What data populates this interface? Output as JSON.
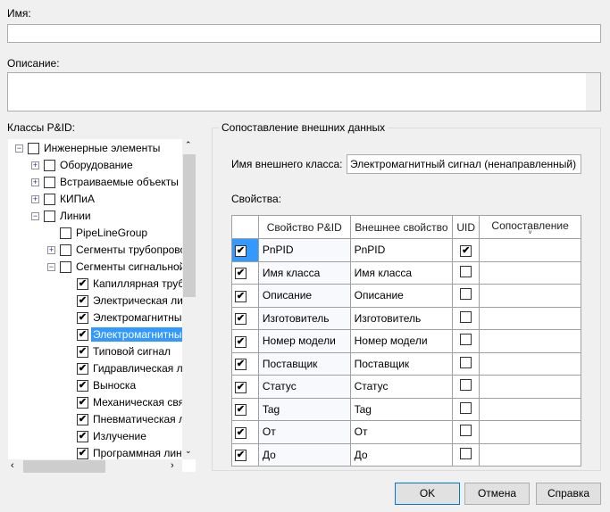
{
  "name": {
    "label": "Имя:",
    "value": ""
  },
  "description": {
    "label": "Описание:",
    "value": ""
  },
  "classes": {
    "label": "Классы P&ID:",
    "items": [
      {
        "text": "Инженерные элементы",
        "level": 0,
        "expander": "minus",
        "checked": false
      },
      {
        "text": "Оборудование",
        "level": 1,
        "expander": "plus",
        "checked": false
      },
      {
        "text": "Встраиваемые объекты",
        "level": 1,
        "expander": "plus",
        "checked": false
      },
      {
        "text": "КИПиА",
        "level": 1,
        "expander": "plus",
        "checked": false
      },
      {
        "text": "Линии",
        "level": 1,
        "expander": "minus",
        "checked": false
      },
      {
        "text": "PipeLineGroup",
        "level": 2,
        "expander": "",
        "checked": false
      },
      {
        "text": "Сегменты трубопровода",
        "level": 2,
        "expander": "plus",
        "checked": false
      },
      {
        "text": "Сегменты сигнальной линии",
        "level": 2,
        "expander": "minus",
        "checked": false
      },
      {
        "text": "Капиллярная трубка",
        "level": 3,
        "checked": true
      },
      {
        "text": "Электрическая линия",
        "level": 3,
        "checked": true
      },
      {
        "text": "Электромагнитный",
        "level": 3,
        "checked": true
      },
      {
        "text": "Электромагнитный",
        "level": 3,
        "checked": true,
        "selected": true
      },
      {
        "text": "Типовой сигнал",
        "level": 3,
        "checked": true
      },
      {
        "text": "Гидравлическая линия",
        "level": 3,
        "checked": true
      },
      {
        "text": "Выноска",
        "level": 3,
        "checked": true
      },
      {
        "text": "Механическая связь",
        "level": 3,
        "checked": true
      },
      {
        "text": "Пневматическая линия",
        "level": 3,
        "checked": true
      },
      {
        "text": "Излучение",
        "level": 3,
        "checked": true
      },
      {
        "text": "Программная линия",
        "level": 3,
        "checked": true
      }
    ]
  },
  "mapping": {
    "title": "Сопоставление внешних данных",
    "external_class_label": "Имя внешнего класса:",
    "external_class_value": "Электромагнитный сигнал (ненаправленный)",
    "properties_label": "Свойства:",
    "columns": [
      "",
      "Свойство P&ID",
      "Внешнее свойство",
      "UID",
      "Сопоставление"
    ],
    "rows": [
      {
        "checked": true,
        "pid": "PnPID",
        "external": "PnPID",
        "uid": true
      },
      {
        "checked": true,
        "pid": "Имя класса",
        "external": "Имя класса",
        "uid": false
      },
      {
        "checked": true,
        "pid": "Описание",
        "external": "Описание",
        "uid": false
      },
      {
        "checked": true,
        "pid": "Изготовитель",
        "external": "Изготовитель",
        "uid": false
      },
      {
        "checked": true,
        "pid": "Номер модели",
        "external": "Номер модели",
        "uid": false
      },
      {
        "checked": true,
        "pid": "Поставщик",
        "external": "Поставщик",
        "uid": false
      },
      {
        "checked": true,
        "pid": "Статус",
        "external": "Статус",
        "uid": false
      },
      {
        "checked": true,
        "pid": "Tag",
        "external": "Tag",
        "uid": false
      },
      {
        "checked": true,
        "pid": "От",
        "external": "От",
        "uid": false
      },
      {
        "checked": true,
        "pid": "До",
        "external": "До",
        "uid": false
      }
    ]
  },
  "buttons": {
    "ok": "OK",
    "cancel": "Отмена",
    "help": "Справка"
  }
}
